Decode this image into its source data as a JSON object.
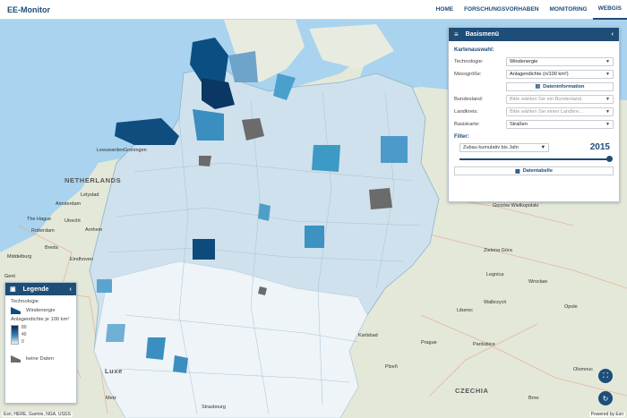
{
  "app": {
    "title": "EE-Monitor"
  },
  "nav": [
    {
      "label": "HOME",
      "active": false
    },
    {
      "label": "FORSCHUNGSVORHABEN",
      "active": false
    },
    {
      "label": "MONITORING",
      "active": false
    },
    {
      "label": "WEBGIS",
      "active": true
    }
  ],
  "panel": {
    "title": "Basismenü",
    "section_map": "Kartenauswahl:",
    "technology_label": "Technologie:",
    "technology_value": "Windenergie",
    "measure_label": "Messgröße:",
    "measure_value": "Anlagendichte (n/100 km²)",
    "info_button": "Dateninformation",
    "state_label": "Bundesland:",
    "state_placeholder": "Bitte wählen Sie ein Bundesland",
    "district_label": "Landkreis:",
    "district_placeholder": "Bitte wählen Sie einen Landkre...",
    "basemap_label": "Basiskarte:",
    "basemap_value": "Straßen",
    "section_filter": "Filter:",
    "filter_value": "Zubau kumulativ bis Jahr",
    "year": "2015",
    "table_button": "Datentabelle"
  },
  "legend": {
    "title": "Legende",
    "technology_heading": "Technologie",
    "technology_item": "Windenergie",
    "density_heading": "Anlagendichte je 100 km²",
    "ticks": [
      "80",
      "40",
      "0"
    ],
    "nodata": "keine Daten"
  },
  "places": [
    {
      "t": "NETHERLANDS",
      "big": true
    },
    {
      "t": "Amsterdam"
    },
    {
      "t": "The Hague"
    },
    {
      "t": "Rotterdam"
    },
    {
      "t": "Utrecht"
    },
    {
      "t": "Middelburg"
    },
    {
      "t": "Leeuwarden"
    },
    {
      "t": "Groningen"
    },
    {
      "t": "Lelystad"
    },
    {
      "t": "Arnhem"
    },
    {
      "t": "Eindhoven"
    },
    {
      "t": "Breda"
    },
    {
      "t": "Gent"
    },
    {
      "t": "Luxe"
    },
    {
      "t": "Metz"
    },
    {
      "t": "Strasbourg"
    },
    {
      "t": "Prague"
    },
    {
      "t": "Pardubice"
    },
    {
      "t": "Plzeň"
    },
    {
      "t": "Karlsbad"
    },
    {
      "t": "Liberec"
    },
    {
      "t": "Legnica"
    },
    {
      "t": "Wrocław"
    },
    {
      "t": "Walbrzych"
    },
    {
      "t": "Opole"
    },
    {
      "t": "Brno"
    },
    {
      "t": "Olomouc"
    },
    {
      "t": "Zielona Góra"
    },
    {
      "t": "Gorzów Wielkopolski"
    },
    {
      "t": "CZECHIA",
      "big": true
    }
  ],
  "attribution": "Esri, HERE, Garmin, NGA, USGS",
  "powered": "Powered by Esri",
  "colors": {
    "brand": "#1e4d78",
    "sea": "#a9d3ee",
    "nodata": "#6b6b6b"
  }
}
